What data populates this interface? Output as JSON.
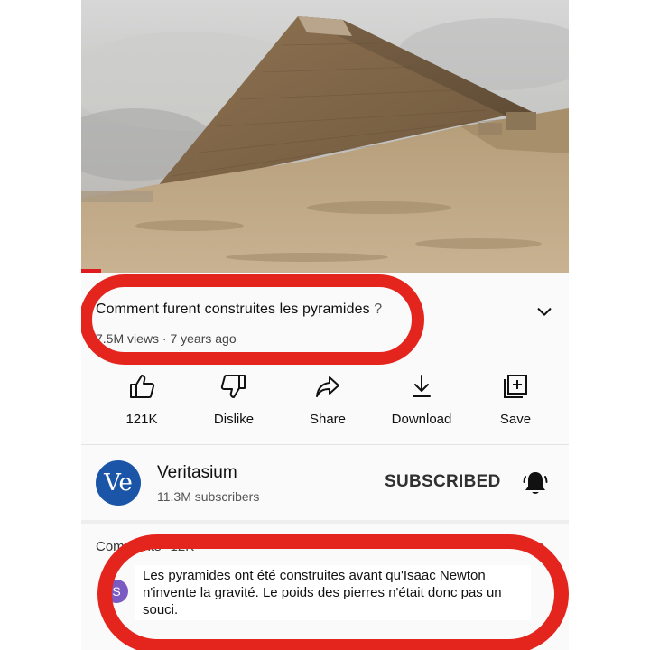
{
  "video": {
    "title": "Comment furent construites les pyramides",
    "title_suffix": " ?",
    "meta": "7.5M views · 7 years ago"
  },
  "actions": [
    {
      "label": "121K",
      "icon": "thumbs-up-icon"
    },
    {
      "label": "Dislike",
      "icon": "thumbs-down-icon"
    },
    {
      "label": "Share",
      "icon": "share-arrow-icon"
    },
    {
      "label": "Download",
      "icon": "download-icon"
    },
    {
      "label": "Save",
      "icon": "add-to-playlist-icon"
    }
  ],
  "channel": {
    "avatar_text": "Ve",
    "name": "Veritasium",
    "subscribers": "11.3M subscribers",
    "subscribe_state": "SUBSCRIBED"
  },
  "comments": {
    "label": "Comments",
    "count": "12K",
    "top_comment": {
      "avatar_letter": "S",
      "text": "Les pyramides ont été construites avant qu'Isaac Newton n'invente la gravité. Le poids des pierres n'était donc pas un souci."
    }
  },
  "colors": {
    "highlight": "#e3251d",
    "progress": "#e0191f",
    "channel_avatar": "#1b55a8"
  }
}
